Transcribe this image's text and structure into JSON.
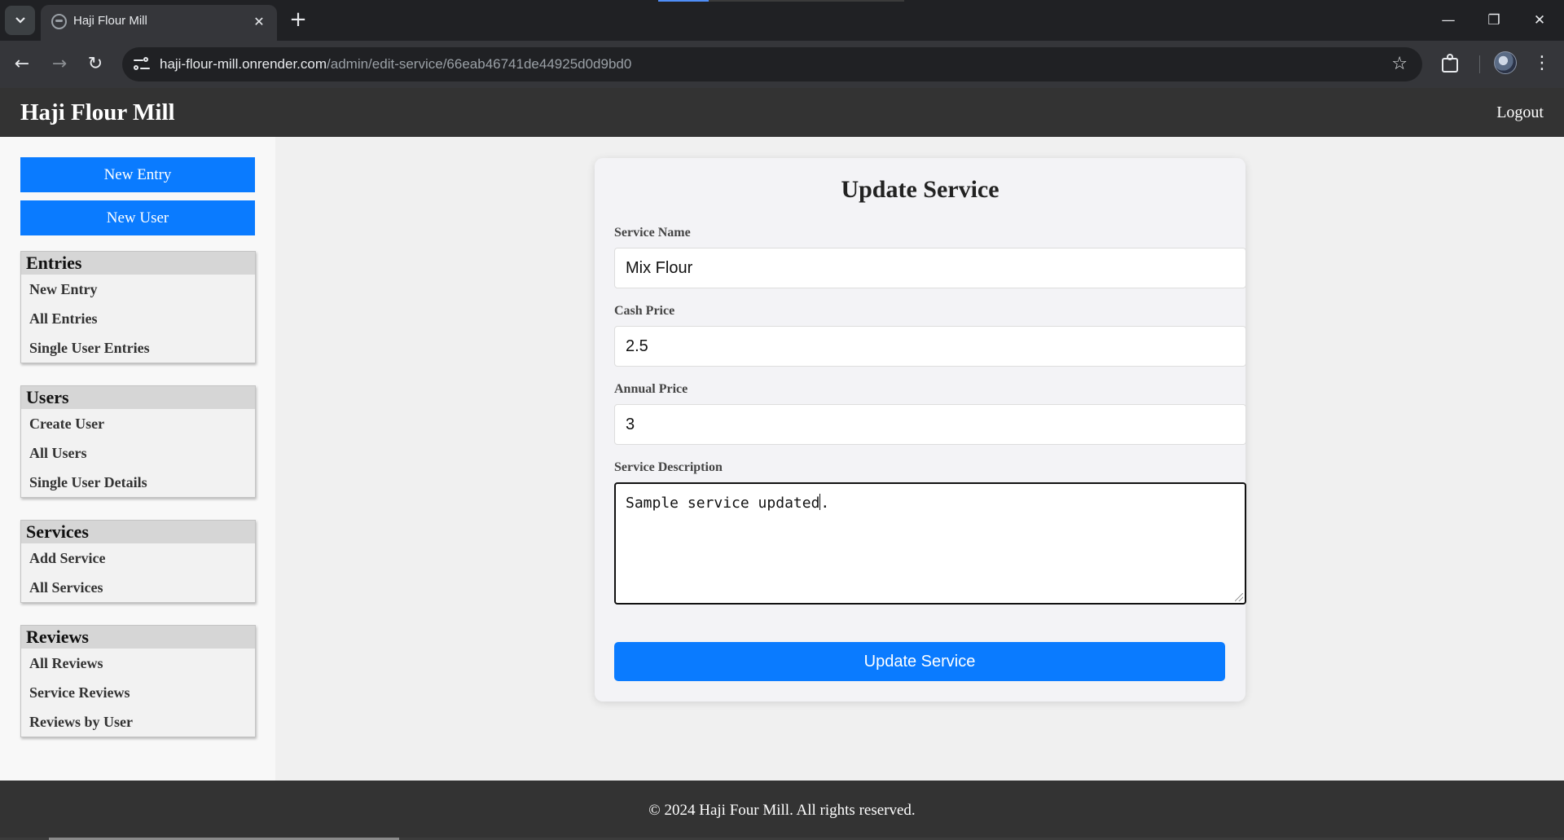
{
  "browser": {
    "tab_title": "Haji Flour Mill",
    "url_host": "haji-flour-mill.onrender.com",
    "url_path": "/admin/edit-service/66eab46741de44925d0d9bd0"
  },
  "header": {
    "brand": "Haji Flour Mill",
    "logout": "Logout"
  },
  "sidebar": {
    "buttons": [
      "New Entry",
      "New User"
    ],
    "groups": [
      {
        "title": "Entries",
        "items": [
          "New Entry",
          "All Entries",
          "Single User Entries"
        ]
      },
      {
        "title": "Users",
        "items": [
          "Create User",
          "All Users",
          "Single User Details"
        ]
      },
      {
        "title": "Services",
        "items": [
          "Add Service",
          "All Services"
        ]
      },
      {
        "title": "Reviews",
        "items": [
          "All Reviews",
          "Service Reviews",
          "Reviews by User"
        ]
      }
    ]
  },
  "form": {
    "title": "Update Service",
    "service_name_label": "Service Name",
    "service_name_value": "Mix Flour",
    "cash_price_label": "Cash Price",
    "cash_price_value": "2.5",
    "annual_price_label": "Annual Price",
    "annual_price_value": "3",
    "description_label": "Service Description",
    "description_before_caret": "Sample service updated",
    "description_after_caret": ".",
    "submit_label": "Update Service"
  },
  "footer": {
    "text": "© 2024 Haji Four Mill. All rights reserved."
  },
  "colors": {
    "primary": "#0a7bff",
    "header_bg": "#333333"
  }
}
